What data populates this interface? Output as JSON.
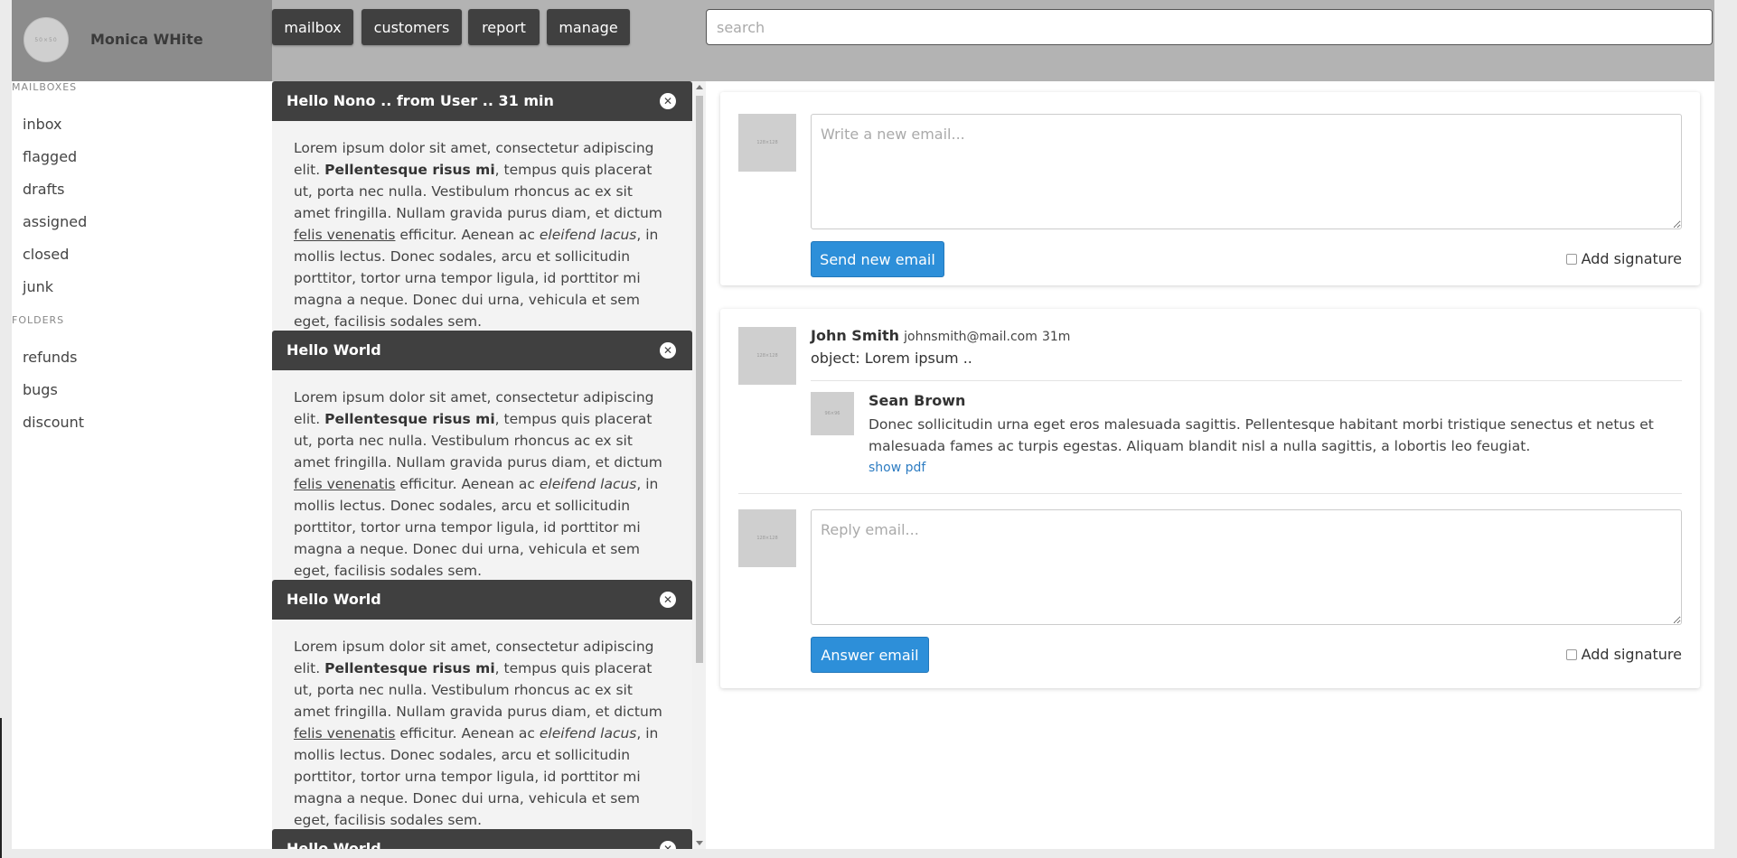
{
  "user": {
    "name": "Monica WHite",
    "avatar_text": "50×50"
  },
  "nav": [
    "mailbox",
    "customers",
    "report",
    "manage"
  ],
  "search": {
    "placeholder": "search"
  },
  "sidebar": {
    "mailboxes_heading": "MAILBOXES",
    "mailboxes": [
      "inbox",
      "flagged",
      "drafts",
      "assigned",
      "closed",
      "junk"
    ],
    "folders_heading": "FOLDERS",
    "folders": [
      "refunds",
      "bugs",
      "discount"
    ]
  },
  "emails": [
    {
      "subject": "Hello Nono .. from User .. 31 min",
      "body": {
        "t1": "Lorem ipsum dolor sit amet, consectetur adipiscing elit.",
        "b1": "Pellentesque risus mi",
        "t2": ", tempus quis placerat ut, porta nec nulla. Vestibulum rhoncus ac ex sit amet fringilla. Nullam gravida purus diam, et dictum ",
        "u1": "felis venenatis",
        "t3": " efficitur. Aenean ac ",
        "i1": "eleifend lacus",
        "t4": ", in mollis lectus. Donec sodales, arcu et sollicitudin porttitor, tortor urna tempor ligula, id porttitor mi magna a neque. Donec dui urna, vehicula et sem eget, facilisis sodales sem."
      }
    },
    {
      "subject": "Hello World",
      "body": {
        "t1": "Lorem ipsum dolor sit amet, consectetur adipiscing elit.",
        "b1": "Pellentesque risus mi",
        "t2": ", tempus quis placerat ut, porta nec nulla. Vestibulum rhoncus ac ex sit amet fringilla. Nullam gravida purus diam, et dictum ",
        "u1": "felis venenatis",
        "t3": " efficitur. Aenean ac ",
        "i1": "eleifend lacus",
        "t4": ", in mollis lectus. Donec sodales, arcu et sollicitudin porttitor, tortor urna tempor ligula, id porttitor mi magna a neque. Donec dui urna, vehicula et sem eget, facilisis sodales sem."
      }
    },
    {
      "subject": "Hello World",
      "body": {
        "t1": "Lorem ipsum dolor sit amet, consectetur adipiscing elit.",
        "b1": "Pellentesque risus mi",
        "t2": ", tempus quis placerat ut, porta nec nulla. Vestibulum rhoncus ac ex sit amet fringilla. Nullam gravida purus diam, et dictum ",
        "u1": "felis venenatis",
        "t3": " efficitur. Aenean ac ",
        "i1": "eleifend lacus",
        "t4": ", in mollis lectus. Donec sodales, arcu et sollicitudin porttitor, tortor urna tempor ligula, id porttitor mi magna a neque. Donec dui urna, vehicula et sem eget, facilisis sodales sem."
      }
    },
    {
      "subject": "Hello World"
    }
  ],
  "compose": {
    "thumb_text": "128×128",
    "placeholder": "Write a new email...",
    "send_label": "Send new email",
    "signature_label": "Add signature"
  },
  "thread": {
    "sender_name": "John Smith",
    "sender_email": "johnsmith@mail.com",
    "time": "31m",
    "object": "object: Lorem ipsum ..",
    "thumb_text": "128×128",
    "reply": {
      "name": "Sean Brown",
      "thumb_text": "96×96",
      "text": "Donec sollicitudin urna eget eros malesuada sagittis. Pellentesque habitant morbi tristique senectus et netus et malesuada fames ac turpis egestas. Aliquam blandit nisl a nulla sagittis, a lobortis leo feugiat.",
      "link": "show pdf"
    },
    "answer": {
      "thumb_text": "128×128",
      "placeholder": "Reply email...",
      "button_label": "Answer email",
      "signature_label": "Add signature"
    }
  },
  "colors": {
    "topbar": "#b3b3b3",
    "profile": "#8c8c8c",
    "dark": "#404040",
    "accent": "#2d8fd9"
  }
}
